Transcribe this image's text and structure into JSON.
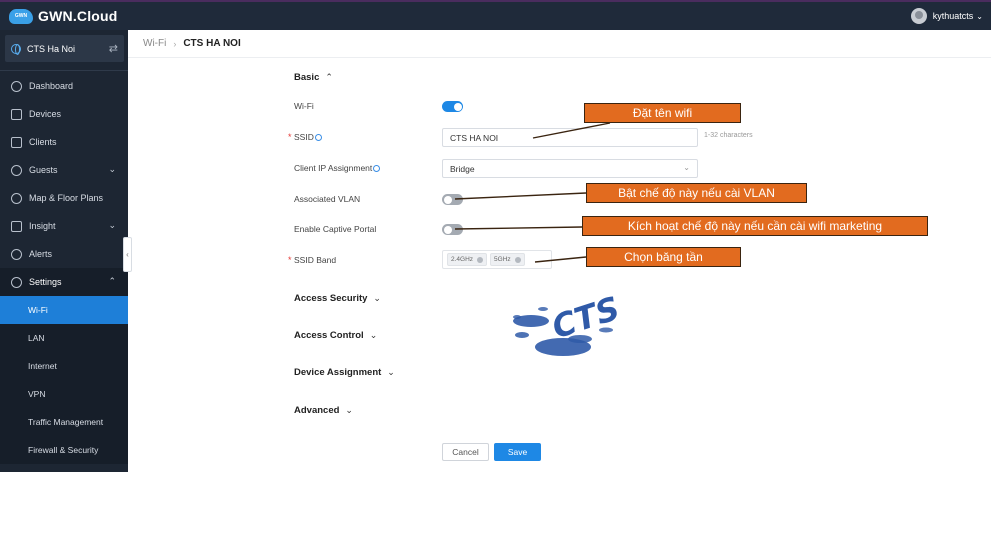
{
  "topbar": {
    "brand": "GWN.Cloud",
    "logo_badge": "GWN",
    "username": "kythuatcts"
  },
  "sidebar": {
    "site_name": "CTS Ha Noi",
    "items": [
      {
        "label": "Dashboard",
        "icon": "dashboard-icon"
      },
      {
        "label": "Devices",
        "icon": "devices-icon"
      },
      {
        "label": "Clients",
        "icon": "clients-icon"
      },
      {
        "label": "Guests",
        "icon": "guests-icon"
      },
      {
        "label": "Map & Floor Plans",
        "icon": "map-icon"
      },
      {
        "label": "Insight",
        "icon": "insight-icon"
      },
      {
        "label": "Alerts",
        "icon": "bell-icon"
      },
      {
        "label": "Settings",
        "icon": "gear-icon"
      }
    ],
    "sub_items": [
      "Wi-Fi",
      "LAN",
      "Internet",
      "VPN",
      "Traffic Management",
      "Firewall & Security"
    ]
  },
  "breadcrumb": {
    "parent": "Wi-Fi",
    "current": "CTS HA NOI"
  },
  "form": {
    "basic_title": "Basic",
    "wifi_label": "Wi-Fi",
    "ssid_label": "SSID",
    "ssid_value": "CTS HA NOI",
    "ssid_hint": "1-32 characters",
    "client_ip_label": "Client IP Assignment",
    "client_ip_value": "Bridge",
    "vlan_label": "Associated VLAN",
    "captive_label": "Enable Captive Portal",
    "band_label": "SSID Band",
    "bands": [
      "2.4GHz",
      "5GHz"
    ],
    "toggles": {
      "wifi": true,
      "vlan": false,
      "captive": false
    }
  },
  "sections": {
    "access_security": "Access Security",
    "access_control": "Access Control",
    "device_assignment": "Device Assignment",
    "advanced": "Advanced"
  },
  "buttons": {
    "cancel": "Cancel",
    "save": "Save"
  },
  "callouts": {
    "ssid": "Đặt tên wifi",
    "vlan": "Bật chế độ này nếu cài VLAN",
    "captive": "Kích hoạt chế độ này nếu cần cài wifi marketing",
    "band": "Chọn băng tần"
  },
  "watermark": "CTS",
  "colors": {
    "accent": "#1e88e5",
    "sidebar": "#1d2633",
    "topbar": "#1f2a3a",
    "callout": "#e26b1f",
    "watermark": "#2f5aa8"
  }
}
